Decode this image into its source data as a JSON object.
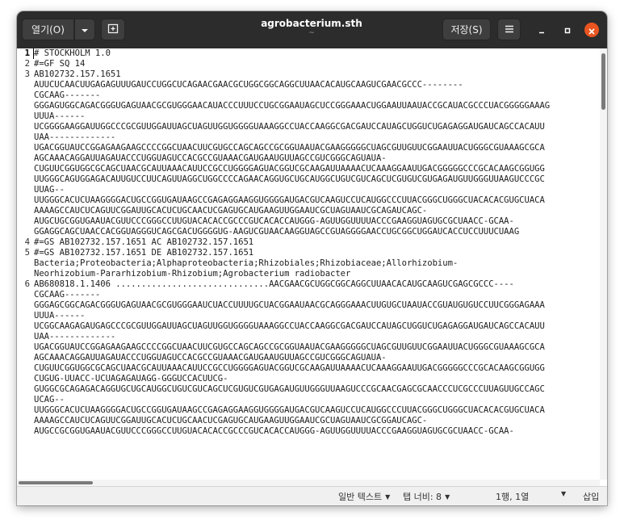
{
  "window": {
    "title": "agrobacterium.sth",
    "subtitle": "~",
    "open_label": "열기(O)",
    "save_label": "저장(S)"
  },
  "icons": {
    "open_dropdown": "chevron-down-icon",
    "new_tab": "new-tab-icon",
    "menu": "hamburger-menu-icon",
    "minimize": "minimize-icon",
    "maximize": "maximize-icon",
    "close": "close-icon"
  },
  "editor": {
    "lines": [
      {
        "num": "1",
        "text": "# STOCKHOLM 1.0"
      },
      {
        "num": "2",
        "text": "#=GF SQ 14"
      },
      {
        "num": "3",
        "text": "AB102732.157.1651"
      },
      {
        "num": "",
        "text": "AUUCUCAACUUGAGAGUUUGAUCCUGGCUCAGAACGAACGCUGGCGGCAGGCUUAACACAUGCAAGUCGAACGCCC--------"
      },
      {
        "num": "",
        "text": "CGCAAG-------"
      },
      {
        "num": "",
        "text": "GGGAGUGGCAGACGGGUGAGUAACGCGUGGGAACAUACCCUUUCCUGCGGAAUAGCUCCGGGAAACUGGAAUUAAUACCGCAUACGCCCUACGGGGGAAAG"
      },
      {
        "num": "",
        "text": "UUUA------"
      },
      {
        "num": "",
        "text": "UCGGGGAAGGAUUGGCCCGCGUUGGAUUAGCUAGUUGGUGGGGUAAAGGCCUACCAAGGCGACGAUCCAUAGCUGGUCUGAGAGGAUGAUCAGCCACAUU"
      },
      {
        "num": "",
        "text": "UAA-------------"
      },
      {
        "num": "",
        "text": "UGACGGUAUCCGGAGAAGAAGCCCCGGCUAACUUCGUGCCAGCAGCCGCGGUAAUACGAAGGGGGCUAGCGUUGUUCGGAAUUACUGGGCGUAAAGCGCA"
      },
      {
        "num": "",
        "text": "AGCAAACAGGAUUAGAUACCCUGGUAGUCCACGCCGUAAACGAUGAAUGUUAGCCGUCGGGCAGUAUA-"
      },
      {
        "num": "",
        "text": "CUGUUCGGUGGCGCAGCUAACGCAUUAAACAUUCCGCCUGGGGAGUACGGUCGCAAGAUUAAAACUCAAAGGAAUUGACGGGGGCCCGCACAAGCGGUGG"
      },
      {
        "num": "",
        "text": "UUGGGCAGUGGAGACAUUGUCCUUCAGUUAGGCUGGCCCCAGAACAGGUGCUGCAUGGCUGUCGUCAGCUCGUGUCGUGAGAUGUUGGGUUAAGUCCCGC"
      },
      {
        "num": "",
        "text": "UUAG--"
      },
      {
        "num": "",
        "text": "UUGGGCACUCUAAGGGGACUGCCGGUGAUAAGCCGAGAGGAAGGUGGGGAUGACGUCAAGUCCUCAUGGCCCUUACGGGCUGGGCUACACACGUGCUACA"
      },
      {
        "num": "",
        "text": "AAAAGCCAUCUCAGUUCGGAUUGCACUCUGCAACUCGAGUGCAUGAAGUUGGAAUCGCUAGUAAUCGCAGAUCAGC-"
      },
      {
        "num": "",
        "text": "AUGCUGCGGUGAAUACGUUCCCGGGCCUUGUACACACCGCCCGUCACACCAUGGG-AGUUGGUUUUACCCGAAGGUAGUGCGCUAACC-GCAA-"
      },
      {
        "num": "",
        "text": "GGAGGCAGCUAACCACGGUAGGGUCAGCGACUGGGGUG-AAGUCGUAACAAGGUAGCCGUAGGGGAACCUGCGGCUGGAUCACCUCCUUUCUAAG"
      },
      {
        "num": "4",
        "text": "#=GS AB102732.157.1651 AC AB102732.157.1651"
      },
      {
        "num": "5",
        "text": "#=GS AB102732.157.1651 DE AB102732.157.1651"
      },
      {
        "num": "",
        "text": "Bacteria;Proteobacteria;Alphaproteobacteria;Rhizobiales;Rhizobiaceae;Allorhizobium-"
      },
      {
        "num": "",
        "text": "Neorhizobium-Pararhizobium-Rhizobium;Agrobacterium radiobacter"
      },
      {
        "num": "6",
        "text": "AB680818.1.1406 ..............................AACGAACGCUGGCGGCAGGCUUAACACAUGCAAGUCGAGCGCCC----"
      },
      {
        "num": "",
        "text": "CGCAAG-------"
      },
      {
        "num": "",
        "text": "GGGAGCGGCAGACGGGUGAGUAACGCGUGGGAAUCUACCUUUUGCUACGGAAUAACGCAGGGAAACUUGUGCUAAUACCGUAUGUGUCCUUCGGGAGAAA"
      },
      {
        "num": "",
        "text": "UUUA------"
      },
      {
        "num": "",
        "text": "UCGGCAAGAGAUGAGCCCGCGUUGGAUUAGCUAGUUGGUGGGGUAAAGGCCUACCAAGGCGACGAUCCAUAGCUGGUCUGAGAGGAUGAUCAGCCACAUU"
      },
      {
        "num": "",
        "text": "UAA-------------"
      },
      {
        "num": "",
        "text": "UGACGGUAUCCGGAGAAGAAGCCCCGGCUAACUUCGUGCCAGCAGCCGCGGUAAUACGAAGGGGGCUAGCGUUGUUCGGAAUUACUGGGCGUAAAGCGCA"
      },
      {
        "num": "",
        "text": "AGCAAACAGGAUUAGAUACCCUGGUAGUCCACGCCGUAAACGAUGAAUGUUAGCCGUCGGGCAGUAUA-"
      },
      {
        "num": "",
        "text": "CUGUUCGGUGGCGCAGCUAACGCAUUAAACAUUCCGCCUGGGGAGUACGGUCGCAAGAUUAAAACUCAAAGGAAUUGACGGGGGCCCGCACAAGCGGUGG"
      },
      {
        "num": "",
        "text": "CUGUG-UUACC-UCUAGAGAUAGG-GGGUCCACUUCG-"
      },
      {
        "num": "",
        "text": "GUGGCGCAGAGACAGGUGCUGCAUGGCUGUCGUCAGCUCGUGUCGUGAGAUGUUGGGUUAAGUCCCGCAACGAGCGCAACCCUCGCCCUUAGUUGCCAGC"
      },
      {
        "num": "",
        "text": "UCAG--"
      },
      {
        "num": "",
        "text": "UUGGGCACUCUAAGGGGACUGCCGGUGAUAAGCCGAGAGGAAGGUGGGGAUGACGUCAAGUCCUCAUGGCCCUUACGGGCUGGGCUACACACGUGCUACA"
      },
      {
        "num": "",
        "text": "AAAAGCCAUCUCAGUUCGGAUUGCACUCUGCAACUCGAGUGCAUGAAGUUGGAAUCGCUAGUAAUCGCGGAUCAGC-"
      },
      {
        "num": "",
        "text": "AUGCCGCGGUGAAUACGUUCCCGGGCCUUGUACACACCGCCCGUCACACCAUGGG-AGUUGGUUUUACCCGAAGGUAGUGCGCUAACC-GCAA-"
      }
    ]
  },
  "statusbar": {
    "syntax": "일반 텍스트",
    "tab_width": "탭 너비: 8",
    "cursor": "1행, 1열",
    "insert_mode": "삽입"
  }
}
